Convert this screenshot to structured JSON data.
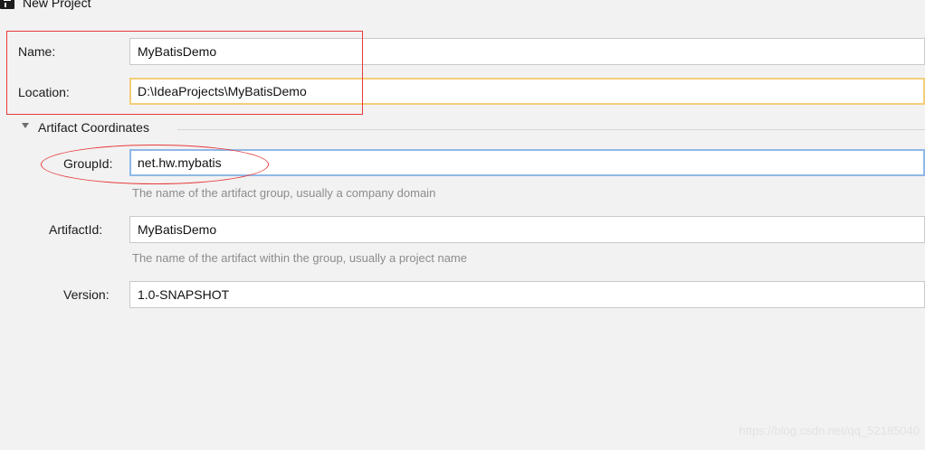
{
  "window": {
    "title": "New Project"
  },
  "form": {
    "name": {
      "label": "Name:",
      "value": "MyBatisDemo"
    },
    "location": {
      "label": "Location:",
      "value": "D:\\IdeaProjects\\MyBatisDemo"
    }
  },
  "artifact_coordinates": {
    "title": "Artifact Coordinates",
    "expanded": true,
    "group_id": {
      "label": "GroupId:",
      "value": "net.hw.mybatis",
      "hint": "The name of the artifact group, usually a company domain"
    },
    "artifact_id": {
      "label": "ArtifactId:",
      "value": "MyBatisDemo",
      "hint": "The name of the artifact within the group, usually a project name"
    },
    "version": {
      "label": "Version:",
      "value": "1.0-SNAPSHOT"
    }
  },
  "watermark": "https://blog.csdn.net/qq_52185040",
  "colors": {
    "background": "#f2f2f2",
    "field_border": "#c9c9c9",
    "focus_orange": "#f4cd7a",
    "focus_blue": "#8fb8e6",
    "annotation_red": "#e8393b",
    "hint_text": "#8c8c8c"
  }
}
